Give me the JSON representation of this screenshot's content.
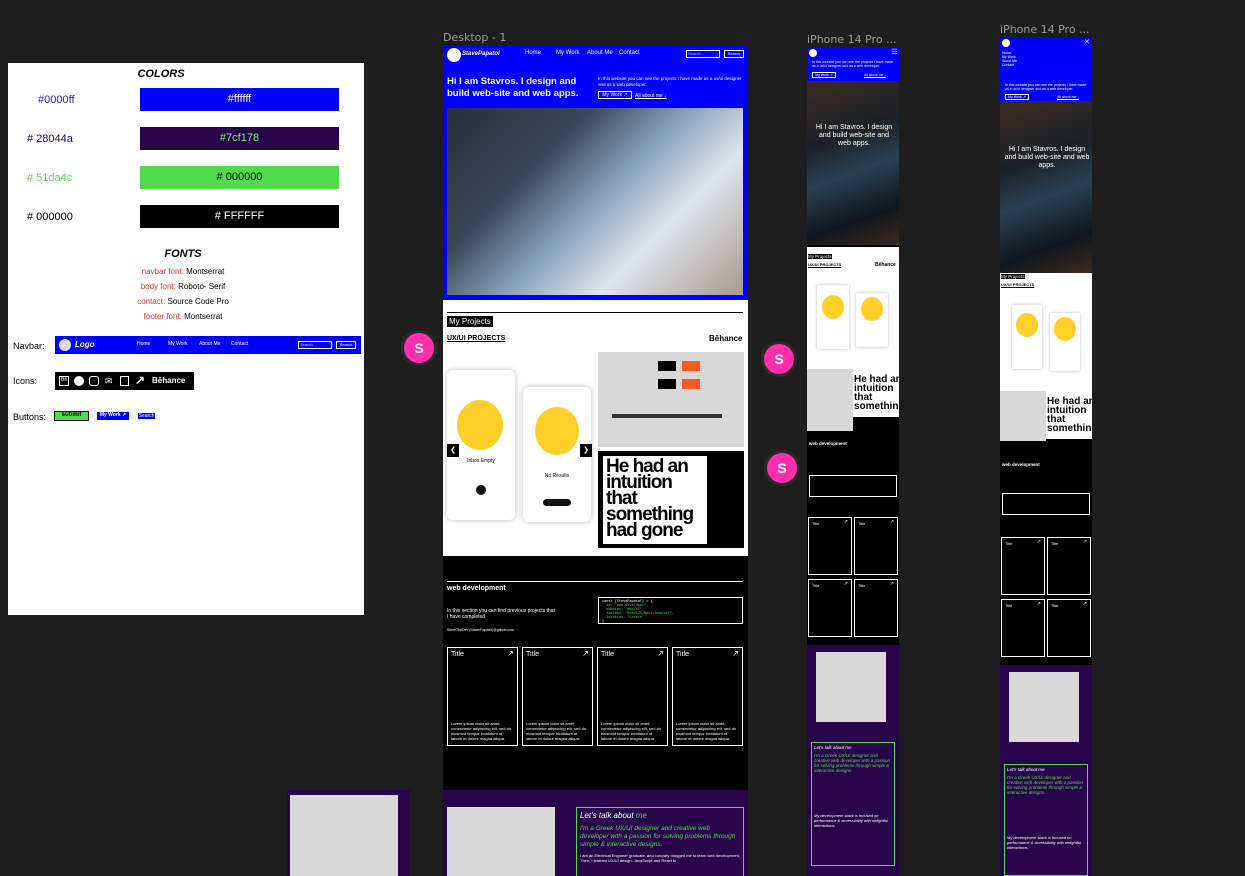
{
  "guide": {
    "colors_title": "COLORS",
    "colors": [
      {
        "label": "#0000ff",
        "bg": "#0000ff",
        "text": "#ffffff",
        "label_color": "#2222bb",
        "text_color": "#ffffff"
      },
      {
        "label": "# 28044a",
        "bg": "#28044a",
        "text": "#7cf178",
        "label_color": "#28044a",
        "text_color": "#7cf178"
      },
      {
        "label": "# 51da4c",
        "bg": "#51da4c",
        "text": "# 000000",
        "label_color": "#51da4c",
        "text_color": "#000000"
      },
      {
        "label": "# 000000",
        "bg": "#000000",
        "text": "# FFFFFF",
        "label_color": "#000000",
        "text_color": "#ffffff"
      }
    ],
    "fonts_title": "FONTS",
    "fonts": [
      {
        "key": "navbar font:",
        "value": "Montserrat"
      },
      {
        "key": "body font:",
        "value": "Roboto- Serif"
      },
      {
        "key": "contact:",
        "value": "Source Code Pro"
      },
      {
        "key": "footer font:",
        "value": "Montserrat"
      }
    ],
    "navbar_label": "Navbar:",
    "navbar_logo": "Logo",
    "navbar_links": [
      "Home",
      "My Work",
      "About Me",
      "Contact"
    ],
    "navbar_search_placeholder": "Search...",
    "navbar_search_button": "Search",
    "icons_label": "Icons:",
    "icons_behance": "Bēhance",
    "buttons_label": "Buttons:",
    "btn_submit": "submit",
    "btn_mywork": "My Work ↗",
    "btn_search": "Search"
  },
  "frames": {
    "desktop": "Desktop - 1",
    "iphone_a": "iPhone 14 Pro ...",
    "iphone_b": "iPhone 14 Pro ..."
  },
  "desktop": {
    "brand": "StavePapatol",
    "nav": [
      "Home",
      "My Work",
      "About Me",
      "Contact"
    ],
    "search_placeholder": "Search...",
    "search_button": "Search",
    "hero_title": "Hi I am Stavros. I design and build web-site and web apps.",
    "hero_text": "In this website you can see the projects I have made as a ux/ui designer and as a web developer.",
    "btn_mywork": "My Work ↗",
    "link_about": "All about me ↓",
    "projects_title": "My Projects",
    "uxui": "UX/UI PROJECTS",
    "behance": "Bēhance",
    "phone1_caption": "Inbox Empty",
    "phone2_caption": "No Results",
    "poster_text": "He had an intuition that something had gone",
    "webdev_title": "web development",
    "webdev_text": "In this section you can find previous projects that I have completed",
    "github": "SteveTheDev (Stave/Papatol)@github.com",
    "code": [
      "const {StevePapatol} = {",
      "  id: \"web-developer\",",
      "  hobbies: \"Web/UI\",",
      "  toolbox: \"ReactJS/Next/Angular\",",
      "  location: \"Greece\"",
      "}"
    ],
    "cards": [
      {
        "title": "Title",
        "desc": "Lorem ipsum dolor sit amet, consectetur adipiscing elit, sed do eiusmod tempor incididunt ut labore et dolore magna aliqua."
      },
      {
        "title": "Title",
        "desc": "Lorem ipsum dolor sit amet, consectetur adipiscing elit, sed do eiusmod tempor incididunt ut labore et dolore magna aliqua."
      },
      {
        "title": "Title",
        "desc": "Lorem ipsum dolor sit amet, consectetur adipiscing elit, sed do eiusmod tempor incididunt ut labore et dolore magna aliqua."
      },
      {
        "title": "Title",
        "desc": "Lorem ipsum dolor sit amet, consectetur adipiscing elit, sed do eiusmod tempor incididunt ut labore et dolore magna aliqua."
      }
    ],
    "talk_title_a": "Let's talk about",
    "talk_title_b": "me",
    "talk_intro": "I'm a Greek UX/UI designer and creative web developer with a passion for solving problems through simple & interactive designs.",
    "talk_body": "I am an Electrical Engineer graduate, and curiosity dragged me to learn web development. Then, I learned UX/UI design, JavaScript and React to",
    "arrow_left": "❮",
    "arrow_right": "❯"
  },
  "mobile": {
    "hero_title": "Hi I am Stavros. I design and build web-site and web apps.",
    "top_text": "In this website you can see the projects I have made as a ux/ui designer and as a web developer.",
    "btn_mywork": "My Work ↗",
    "link_about": "All about me ↓",
    "projects": "My Projects",
    "uxui": "UX/UI PROJECTS",
    "behance": "Bēhance",
    "poster_text": "He had an intuition that something",
    "webdev_title": "web development",
    "card_title": "Title",
    "talk_title": "Let's talk about me",
    "talk_intro": "I'm a Greek UX/UI designer and creative web developer with a passion for solving problems through simple & interactive designs.",
    "talk_stack": "My development stack is focused on performance & accessibility with delightful interactions."
  },
  "avatar_letter": "S"
}
